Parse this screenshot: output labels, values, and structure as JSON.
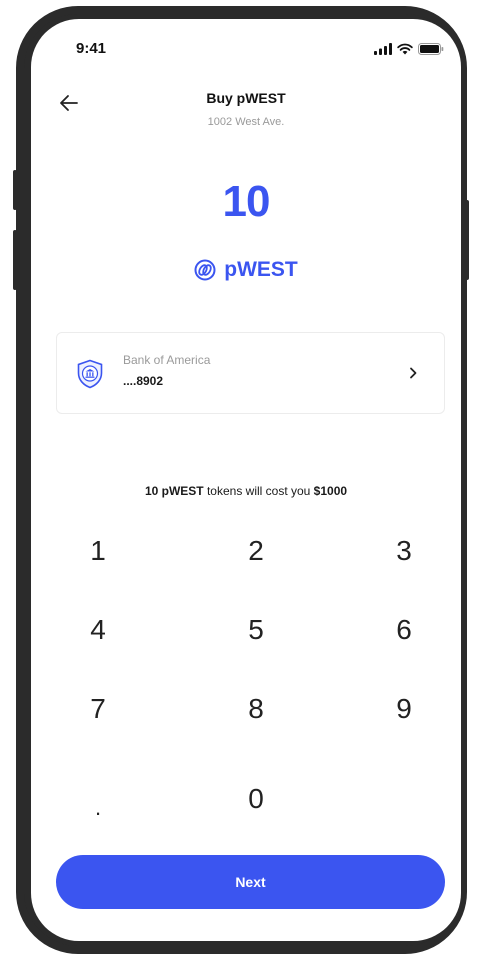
{
  "status": {
    "time": "9:41"
  },
  "header": {
    "title": "Buy pWEST",
    "subtitle": "1002 West Ave."
  },
  "amount": {
    "value": "10",
    "token_label": "pWEST"
  },
  "bank": {
    "name": "Bank of America",
    "account": "....8902"
  },
  "cost": {
    "tokens": "10 pWEST",
    "middle": " tokens will cost you ",
    "price": "$1000"
  },
  "keypad": {
    "k1": "1",
    "k2": "2",
    "k3": "3",
    "k4": "4",
    "k5": "5",
    "k6": "6",
    "k7": "7",
    "k8": "8",
    "k9": "9",
    "kdot": ".",
    "k0": "0"
  },
  "next_label": "Next",
  "colors": {
    "accent": "#3b55f0",
    "frame": "#2b2b2b"
  }
}
